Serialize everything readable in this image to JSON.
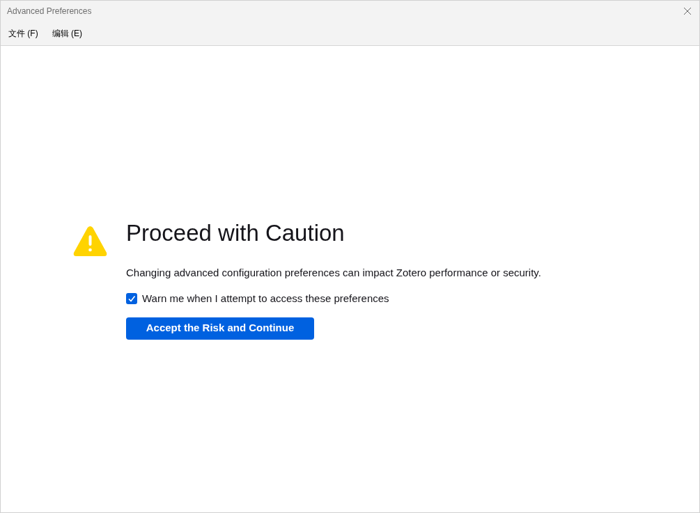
{
  "window": {
    "title": "Advanced Preferences"
  },
  "menu": [
    {
      "label": "文件 (F)"
    },
    {
      "label": "编辑 (E)"
    }
  ],
  "warning": {
    "heading": "Proceed with Caution",
    "message": "Changing advanced configuration preferences can impact Zotero performance or security.",
    "checkbox": {
      "label": "Warn me when I attempt to access these preferences",
      "checked": true
    },
    "button": "Accept the Risk and Continue"
  }
}
